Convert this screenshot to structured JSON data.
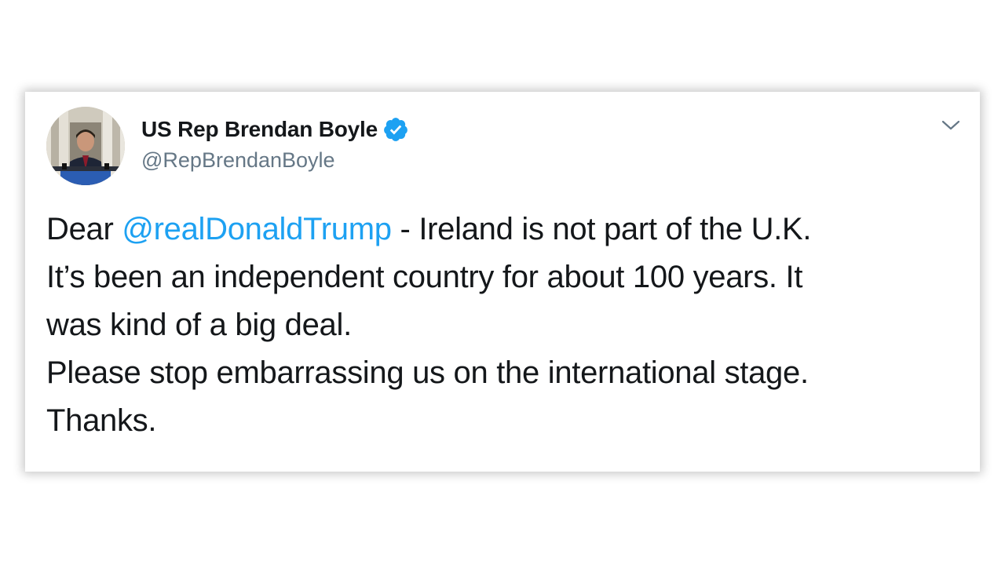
{
  "tweet": {
    "author": {
      "display_name": "US Rep Brendan Boyle",
      "handle": "@RepBrendanBoyle",
      "verified_icon": "verified-badge-icon",
      "avatar": "profile-photo"
    },
    "menu_icon": "chevron-down-icon",
    "body": {
      "prefix": "Dear ",
      "mention": "@realDonaldTrump",
      "line1_rest": " - Ireland is not part of the U.K.",
      "line2": "It’s been an independent country for about 100 years. It",
      "line3": "was kind of a big deal.",
      "line4": "Please stop embarrassing us on the international stage.",
      "line5": "Thanks."
    },
    "colors": {
      "mention": "#1da1f2",
      "verified": "#1da1f2",
      "handle": "#657786",
      "text": "#14171a"
    }
  }
}
